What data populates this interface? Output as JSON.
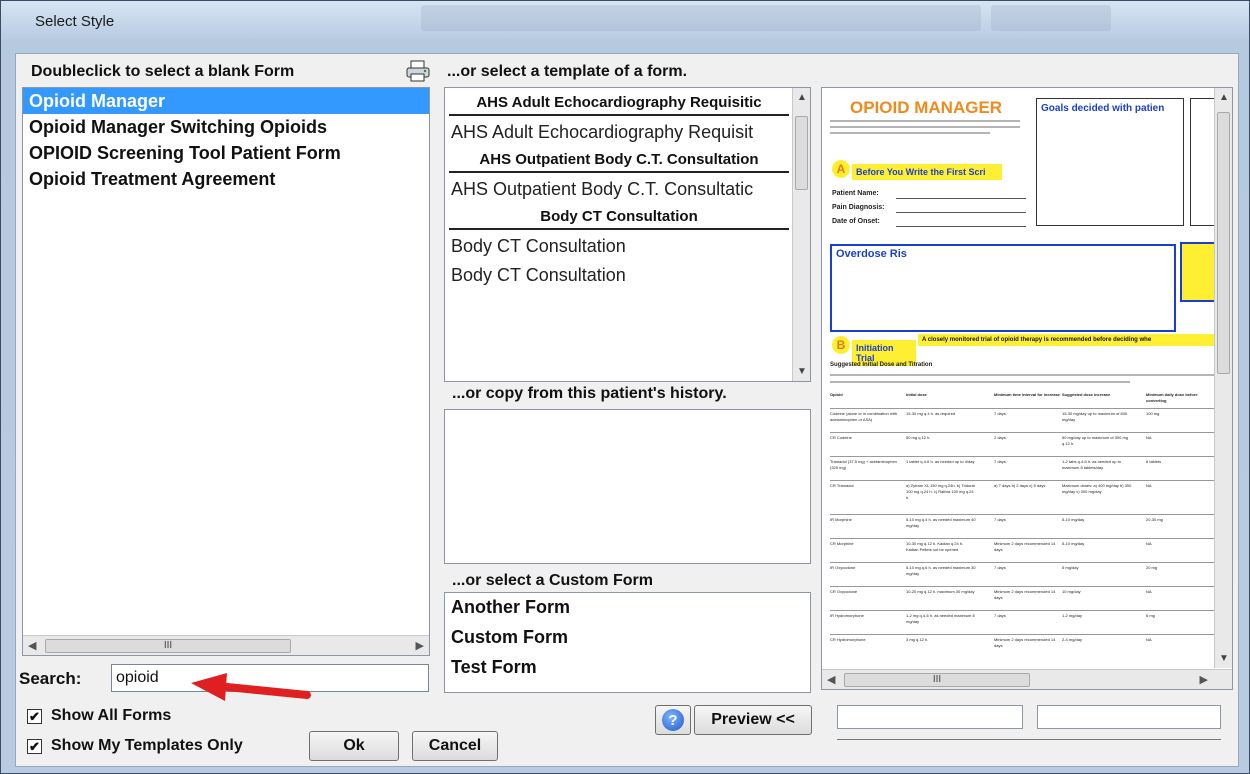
{
  "window": {
    "title": "Select Style"
  },
  "blank_forms": {
    "header": "Doubleclick to select a blank Form",
    "print_icon": "printer-icon",
    "items": [
      "Opioid Manager",
      "Opioid Manager Switching Opioids",
      "OPIOID Screening Tool Patient Form",
      "Opioid Treatment Agreement"
    ],
    "selected_index": 0,
    "scroll_thumb_glyph": "III"
  },
  "templates": {
    "header": "...or select a template of a form.",
    "groups": [
      {
        "title": "AHS Adult Echocardiography Requisitic",
        "items": [
          "AHS Adult Echocardiography Requisit"
        ]
      },
      {
        "title": "AHS Outpatient Body C.T. Consultation",
        "items": [
          "AHS Outpatient Body C.T. Consultatic"
        ]
      },
      {
        "title": "Body CT Consultation",
        "items": [
          "Body CT Consultation",
          "Body CT Consultation"
        ]
      }
    ]
  },
  "history": {
    "header": "...or copy from this patient's history."
  },
  "custom_forms": {
    "header": "...or select a Custom Form",
    "items": [
      "Another Form",
      "Custom Form",
      "Test Form"
    ]
  },
  "search": {
    "label": "Search:",
    "value": "opioid"
  },
  "options": {
    "show_all_forms": {
      "label": "Show All Forms",
      "checked": true
    },
    "show_my_templates": {
      "label": "Show My Templates Only",
      "checked": true
    }
  },
  "buttons": {
    "ok": "Ok",
    "cancel": "Cancel",
    "preview": "Preview <<",
    "help_icon": "help-icon"
  },
  "preview_doc": {
    "title": "OPIOID MANAGER",
    "goals_text": "Goals decided with patien",
    "section_a_letter": "A",
    "section_a_title": "Before You Write the First Scri",
    "fields": [
      "Patient Name:",
      "Pain Diagnosis:",
      "Date of Onset:"
    ],
    "risk_title": "Overdose Ris",
    "section_b_letter": "B",
    "section_b_title": "Initiation Trial",
    "section_b_note": "A closely monitored trial of opioid therapy is recommended before deciding whe",
    "dosing_heading": "Suggested Initial Dose and Titration",
    "table_headers": [
      "Opioid",
      "Initial dose",
      "Minimum time interval for increase",
      "Suggested dose increase",
      "Minimum daily dose before converting"
    ],
    "table_rows": [
      {
        "opioid": "Codeine (alone or in combination with acetaminophen or ASA)",
        "initial": "15-30 mg q.4 h. as required",
        "min_time": "7 days",
        "suggested": "15-30 mg/day up to maximum of 600 mg/day",
        "min_daily": "100 mg"
      },
      {
        "opioid": "CR Codeine",
        "initial": "50 mg q.12 h.",
        "min_time": "2 days",
        "suggested": "50 mg/day up to maximum of 300 mg q.12 h.",
        "min_daily": "NA"
      },
      {
        "opioid": "Tramadol (37.5 mg) + acetaminophen (325 mg)",
        "initial": "1 tablet q.4-6 h. as needed up to 4/day",
        "min_time": "7 days",
        "suggested": "1-2 tabs q.4-6 h. as needed up to maximum 8 tablets/day",
        "min_daily": "6 tablets"
      },
      {
        "opioid": "CR Tramadol",
        "initial": "a) Zytram XL 150 mg q.24h. b) Tridural 100 mg q.24 h. c) Ralivia 100 mg q.24 h.",
        "min_time": "a) 7 days b) 2 days c) 5 days",
        "suggested": "Maximum doses: a) 400 mg/day b) 300 mg/day c) 300 mg/day",
        "min_daily": "NA"
      },
      {
        "opioid": "IR Morphine",
        "initial": "5-10 mg q.4 h. as needed maximum 40 mg/day",
        "min_time": "7 days",
        "suggested": "5-10 mg/day",
        "min_daily": "20-30 mg"
      },
      {
        "opioid": "CR Morphine",
        "initial": "10-30 mg q.12 h. Kadian q.24 h. Kadian Pellets not be opened",
        "min_time": "Minimum 2 days recommended 14 days",
        "suggested": "5-10 mg/day",
        "min_daily": "NA"
      },
      {
        "opioid": "IR Oxycodone",
        "initial": "5-10 mg q.6 h. as needed maximum 30 mg/day",
        "min_time": "7 days",
        "suggested": "5 mg/day",
        "min_daily": "20 mg"
      },
      {
        "opioid": "CR Oxycodone",
        "initial": "10-20 mg q.12 h. maximum 30 mg/day",
        "min_time": "Minimum 2 days recommended 14 days",
        "suggested": "10 mg/day",
        "min_daily": "NA"
      },
      {
        "opioid": "IR Hydromorphone",
        "initial": "1-2 mg q.4-6 h. as needed maximum 8 mg/day",
        "min_time": "7 days",
        "suggested": "1-2 mg/day",
        "min_daily": "6 mg"
      },
      {
        "opioid": "CR Hydromorphone",
        "initial": "3 mg q.12 h.",
        "min_time": "Minimum 2 days recommended 14 days",
        "suggested": "2-4 mg/day",
        "min_daily": "NA"
      }
    ],
    "scroll_thumb_glyph": "III"
  },
  "colors": {
    "selection": "#3399ff",
    "annotation_arrow": "#e02020",
    "doc_title": "#f08a1c",
    "doc_highlight": "#ffef33",
    "doc_blue": "#1a3fd0"
  }
}
